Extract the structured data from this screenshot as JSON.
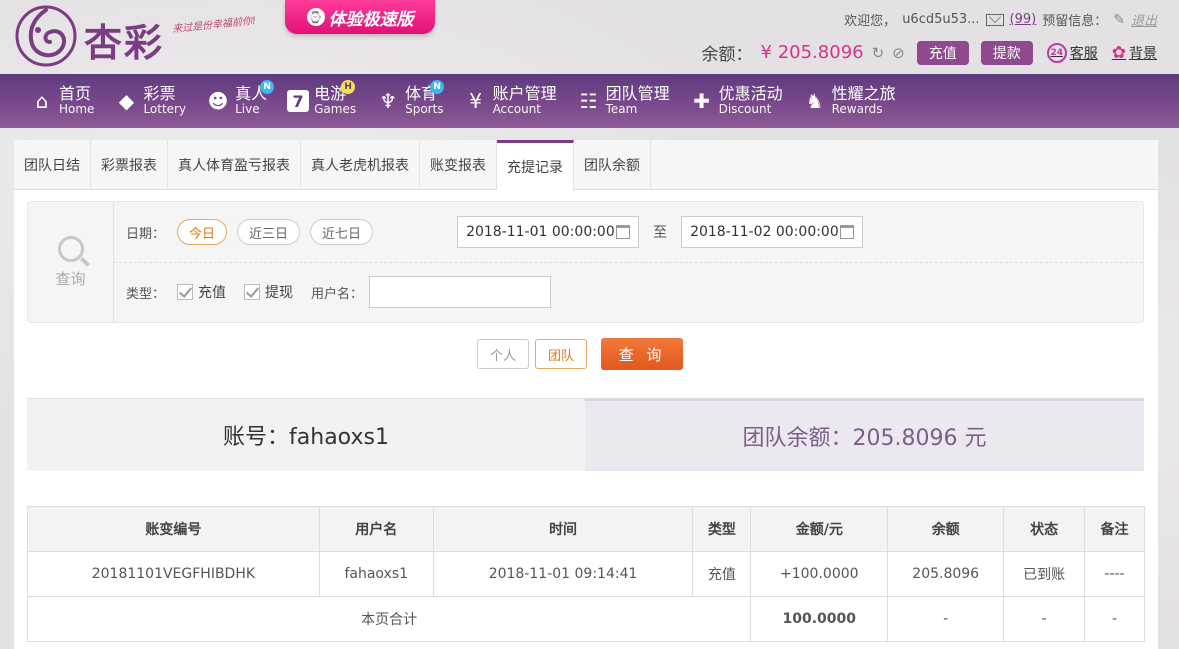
{
  "header": {
    "logo_text": "杏彩",
    "logo_slogan": "来过是份幸福前你!",
    "promo_icon": "⌚",
    "promo_label": "体验极速版",
    "welcome": "欢迎您，",
    "username": "u6cd5u53...",
    "message_count": "(99)",
    "reserve_label": "预留信息：",
    "logout": "退出",
    "balance_label": "余额：",
    "balance_value": "¥ 205.8096",
    "deposit_btn": "充值",
    "withdraw_btn": "提款",
    "support_icon_text": "24",
    "support_label": "客服",
    "background_label": "背景"
  },
  "nav": [
    {
      "cn": "首页",
      "en": "Home",
      "icon": "⌂"
    },
    {
      "cn": "彩票",
      "en": "Lottery",
      "icon": "◆"
    },
    {
      "cn": "真人",
      "en": "Live",
      "icon": "☻",
      "badge": "N"
    },
    {
      "cn": "电游",
      "en": "Games",
      "icon": "7",
      "badge": "H"
    },
    {
      "cn": "体育",
      "en": "Sports",
      "icon": "♆",
      "badge": "N"
    },
    {
      "cn": "账户管理",
      "en": "Account",
      "icon": "¥"
    },
    {
      "cn": "团队管理",
      "en": "Team",
      "icon": "☷"
    },
    {
      "cn": "优惠活动",
      "en": "Discount",
      "icon": "✚"
    },
    {
      "cn": "性耀之旅",
      "en": "Rewards",
      "icon": "♞"
    }
  ],
  "tabs": [
    "团队日结",
    "彩票报表",
    "真人体育盈亏报表",
    "真人老虎机报表",
    "账变报表",
    "充提记录",
    "团队余额"
  ],
  "active_tab": 5,
  "search": {
    "side_label": "查询",
    "date_label": "日期：",
    "ranges": [
      "今日",
      "近三日",
      "近七日"
    ],
    "start_date": "2018-11-01 00:00:00",
    "to_label": "至",
    "end_date": "2018-11-02 00:00:00",
    "type_label": "类型：",
    "type_deposit": "充值",
    "type_withdraw": "提现",
    "username_label": "用户名：",
    "username_value": "",
    "scope_personal": "个人",
    "scope_team": "团队",
    "query_button": "查 询"
  },
  "summary": {
    "account_text": "账号：fahaoxs1",
    "team_balance_text": "团队余额：205.8096 元"
  },
  "table": {
    "headers": [
      "账变编号",
      "用户名",
      "时间",
      "类型",
      "金额/元",
      "余额",
      "状态",
      "备注"
    ],
    "rows": [
      [
        "20181101VEGFHIBDHK",
        "fahaoxs1",
        "2018-11-01 09:14:41",
        "充值",
        "+100.0000",
        "205.8096",
        "已到账",
        "----"
      ]
    ],
    "total_label": "本页合计",
    "total_amount": "100.0000",
    "total_balance": "-",
    "total_status": "-",
    "total_note": "-"
  }
}
